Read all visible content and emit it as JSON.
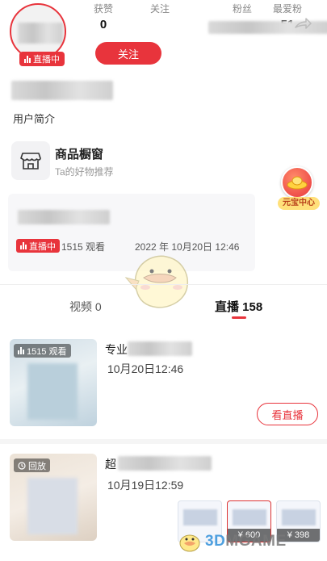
{
  "profile": {
    "live_badge": "直播中",
    "follow_label": "关注",
    "bio": "用户简介"
  },
  "stats": {
    "likes_label": "获赞",
    "likes_value": "0",
    "following_label": "关注",
    "fans_label": "粉丝",
    "top_fans_label": "最爱粉",
    "top_fans_value": "51"
  },
  "shop": {
    "title": "商品橱窗",
    "subtitle": "Ta的好物推荐"
  },
  "yuanbao": {
    "label": "元宝中心"
  },
  "live_card": {
    "badge": "直播中",
    "viewers": "1515 观看",
    "time": "2022 年 10月20日 12:46"
  },
  "tabs": {
    "video": "视频 0",
    "live": "直播 158"
  },
  "items": [
    {
      "badge": "1515 观看",
      "title_prefix": "专业",
      "date": "10月20日12:46",
      "action": "看直播"
    },
    {
      "badge": "回放",
      "title_prefix": "超",
      "date": "10月19日12:59"
    }
  ],
  "products": [
    {
      "price": "¥ 600"
    },
    {
      "price": "¥ 398"
    }
  ],
  "watermark": {
    "text_3d": "3D",
    "text_rest": "MGAME"
  },
  "colors": {
    "accent": "#e8343c",
    "yuanbao_label_bg": "#ffe07a"
  }
}
